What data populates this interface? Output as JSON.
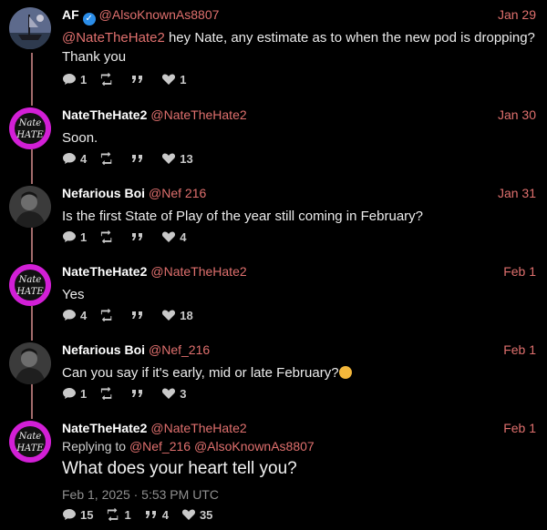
{
  "tweets": [
    {
      "name": "AF",
      "handle": "@AlsoKnownAs8807",
      "date": "Jan 29",
      "mention": "@NateTheHate2",
      "text": " hey Nate, any estimate as to when the new pod is dropping? Thank you",
      "replies": "1",
      "likes": "1",
      "verified": true
    },
    {
      "name": "NateTheHate2",
      "handle": "@NateTheHate2",
      "date": "Jan 30",
      "text": "Soon.",
      "replies": "4",
      "likes": "13"
    },
    {
      "name": "Nefarious Boi",
      "handle": "@Nef  216",
      "date": "Jan 31",
      "text": "Is the first State of Play of the year still coming in February?",
      "replies": "1",
      "likes": "4"
    },
    {
      "name": "NateTheHate2",
      "handle": "@NateTheHate2",
      "date": "Feb 1",
      "text": "Yes",
      "replies": "4",
      "likes": "18"
    },
    {
      "name": "Nefarious Boi",
      "handle": "@Nef_216",
      "date": "Feb 1",
      "text": "Can you say if it's early, mid or late February?",
      "emoji": "thinking-face-emoji",
      "replies": "1",
      "likes": "3"
    },
    {
      "name": "NateTheHate2",
      "handle": "@NateTheHate2",
      "date": "Feb 1",
      "replying_label": "Replying to ",
      "replying_handles": "@Nef_216 @AlsoKnownAs8807",
      "text": "What does your heart tell you?",
      "timestamp": "Feb 1, 2025 · 5:53 PM UTC",
      "replies": "15",
      "retweets": "1",
      "quotes": "4",
      "likes": "35"
    }
  ],
  "colors": {
    "background": "#000000",
    "accent": "#e0706e",
    "thread_line": "#a26b6b",
    "verified": "#2b8de8",
    "avatar_magenta": "#d21fd6"
  },
  "icons": {
    "reply": "comment-icon",
    "retweet": "retweet-icon",
    "quote": "quote-icon",
    "like": "heart-icon"
  }
}
